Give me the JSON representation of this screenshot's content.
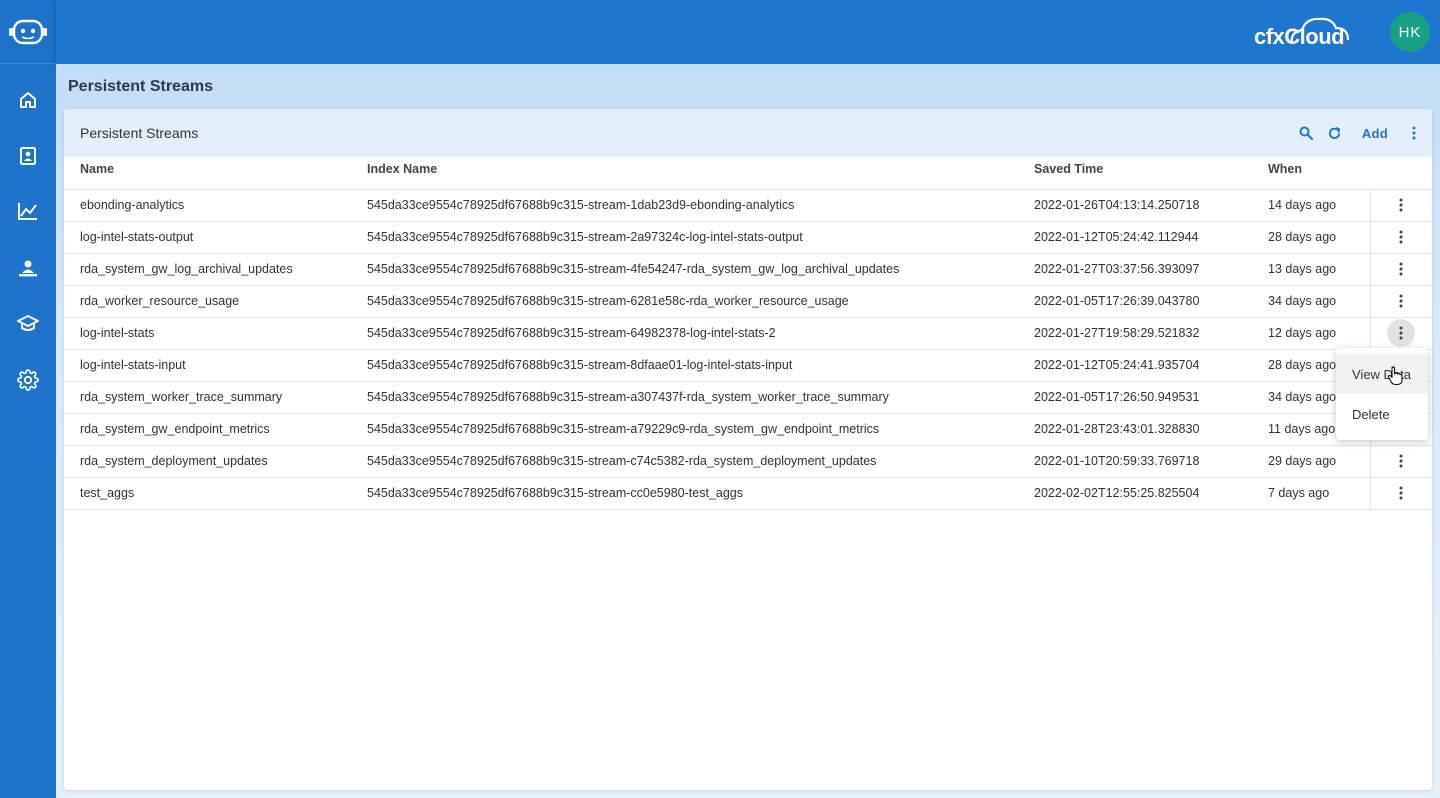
{
  "app": {
    "brand": "cfxCloud",
    "user_initials": "HK"
  },
  "sidebar": {
    "items": [
      {
        "name": "home-icon"
      },
      {
        "name": "contacts-icon"
      },
      {
        "name": "analytics-chart-icon"
      },
      {
        "name": "user-desk-icon"
      },
      {
        "name": "education-icon"
      },
      {
        "name": "settings-gear-icon"
      }
    ]
  },
  "page": {
    "title": "Persistent Streams"
  },
  "card": {
    "title": "Persistent Streams",
    "add_label": "Add"
  },
  "table": {
    "columns": [
      "Name",
      "Index Name",
      "Saved Time",
      "When"
    ],
    "rows": [
      {
        "name": "ebonding-analytics",
        "index": "545da33ce9554c78925df67688b9c315-stream-1dab23d9-ebonding-analytics",
        "saved": "2022-01-26T04:13:14.250718",
        "when": "14 days ago"
      },
      {
        "name": "log-intel-stats-output",
        "index": "545da33ce9554c78925df67688b9c315-stream-2a97324c-log-intel-stats-output",
        "saved": "2022-01-12T05:24:42.112944",
        "when": "28 days ago"
      },
      {
        "name": "rda_system_gw_log_archival_updates",
        "index": "545da33ce9554c78925df67688b9c315-stream-4fe54247-rda_system_gw_log_archival_updates",
        "saved": "2022-01-27T03:37:56.393097",
        "when": "13 days ago"
      },
      {
        "name": "rda_worker_resource_usage",
        "index": "545da33ce9554c78925df67688b9c315-stream-6281e58c-rda_worker_resource_usage",
        "saved": "2022-01-05T17:26:39.043780",
        "when": "34 days ago"
      },
      {
        "name": "log-intel-stats",
        "index": "545da33ce9554c78925df67688b9c315-stream-64982378-log-intel-stats-2",
        "saved": "2022-01-27T19:58:29.521832",
        "when": "12 days ago"
      },
      {
        "name": "log-intel-stats-input",
        "index": "545da33ce9554c78925df67688b9c315-stream-8dfaae01-log-intel-stats-input",
        "saved": "2022-01-12T05:24:41.935704",
        "when": "28 days ago"
      },
      {
        "name": "rda_system_worker_trace_summary",
        "index": "545da33ce9554c78925df67688b9c315-stream-a307437f-rda_system_worker_trace_summary",
        "saved": "2022-01-05T17:26:50.949531",
        "when": "34 days ago"
      },
      {
        "name": "rda_system_gw_endpoint_metrics",
        "index": "545da33ce9554c78925df67688b9c315-stream-a79229c9-rda_system_gw_endpoint_metrics",
        "saved": "2022-01-28T23:43:01.328830",
        "when": "11 days ago"
      },
      {
        "name": "rda_system_deployment_updates",
        "index": "545da33ce9554c78925df67688b9c315-stream-c74c5382-rda_system_deployment_updates",
        "saved": "2022-01-10T20:59:33.769718",
        "when": "29 days ago"
      },
      {
        "name": "test_aggs",
        "index": "545da33ce9554c78925df67688b9c315-stream-cc0e5980-test_aggs",
        "saved": "2022-02-02T12:55:25.825504",
        "when": "7 days ago"
      }
    ]
  },
  "row_menu": {
    "items": [
      "View Data",
      "Delete"
    ]
  },
  "colors": {
    "primary": "#1f76cf",
    "sidebar": "#1d72c9",
    "avatar": "#17a086",
    "header_bg": "#e3effa"
  }
}
